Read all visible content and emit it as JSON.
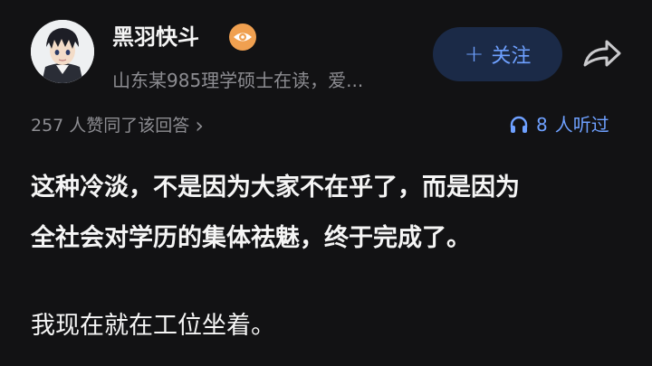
{
  "author": {
    "name": "黑羽快斗",
    "bio": "山东某985理学硕士在读，爱..."
  },
  "follow_button": {
    "plus": "+",
    "label": "关注"
  },
  "stats": {
    "likes_text": "257 人赞同了该回答",
    "likes_chevron": "›",
    "listen_count": "8",
    "listen_text": "人听过"
  },
  "answer": {
    "line1": "这种冷淡，不是因为大家不在乎了，而是因为",
    "line2": "全社会对学历的集体祛魅，终于完成了。",
    "paragraph2": "我现在就在工位坐着。"
  },
  "icons": {
    "badge": "orange-eye-badge-icon",
    "share": "share-arrow-icon",
    "listen": "headphones-icon"
  },
  "colors": {
    "background": "#121214",
    "accent": "#6ea0ff",
    "follow_bg": "#1b2a47",
    "muted_text": "#8d8d92",
    "badge": "#f0a050"
  }
}
